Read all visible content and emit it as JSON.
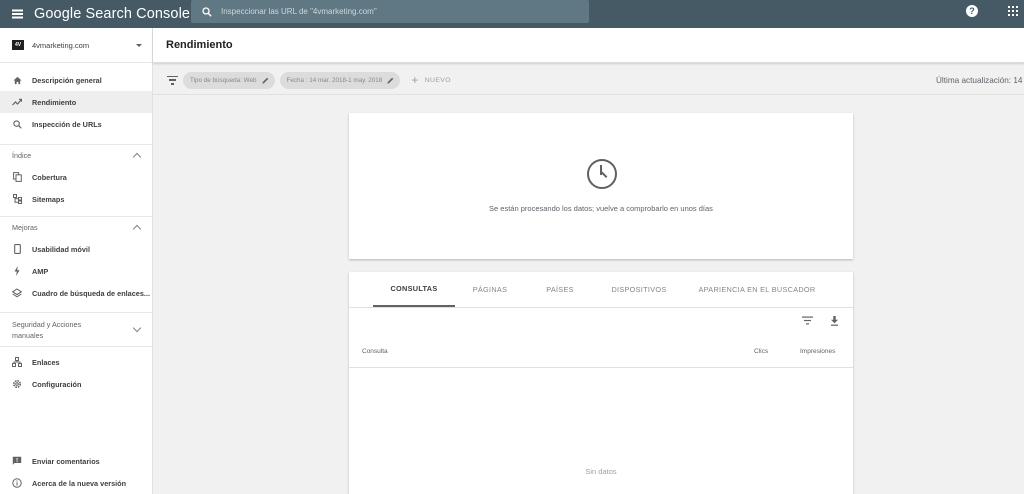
{
  "app": {
    "title": "Google Search Console"
  },
  "search": {
    "placeholder": "Inspeccionar las URL de \"4vmarketing.com\""
  },
  "property": {
    "logo_text": "4V",
    "name": "4vmarketing.com"
  },
  "sidebar": {
    "top_items": [
      {
        "label": "Descripción general",
        "icon": "home-icon"
      },
      {
        "label": "Rendimiento",
        "icon": "trending-up-icon",
        "active": true
      },
      {
        "label": "Inspección de URLs",
        "icon": "search-icon"
      }
    ],
    "sections": [
      {
        "title": "Índice",
        "items": [
          {
            "label": "Cobertura",
            "icon": "file-copy-icon"
          },
          {
            "label": "Sitemaps",
            "icon": "sitemap-icon"
          }
        ]
      },
      {
        "title": "Mejoras",
        "items": [
          {
            "label": "Usabilidad móvil",
            "icon": "phone-icon"
          },
          {
            "label": "AMP",
            "icon": "bolt-icon"
          },
          {
            "label": "Cuadro de búsqueda de enlaces...",
            "icon": "layers-icon"
          }
        ]
      },
      {
        "title": "Seguridad y Acciones manuales"
      }
    ],
    "other_items": [
      {
        "label": "Enlaces",
        "icon": "links-icon"
      },
      {
        "label": "Configuración",
        "icon": "gear-icon"
      }
    ],
    "bottom_items": [
      {
        "label": "Enviar comentarios",
        "icon": "feedback-icon"
      },
      {
        "label": "Acerca de la nueva versión",
        "icon": "info-icon"
      }
    ]
  },
  "header": {
    "title": "Rendimiento"
  },
  "filters": {
    "chips": [
      {
        "label": "Tipo de búsqueda: Web"
      },
      {
        "label": "Fecha : 14 mar. 2018-1 may. 2018"
      }
    ],
    "new_label": "NUEVO",
    "last_update": "Última actualización: 14"
  },
  "status_card": {
    "message": "Se están procesando los datos; vuelve a comprobarlo en unos días"
  },
  "table_card": {
    "tabs": [
      "CONSULTAS",
      "PÁGINAS",
      "PAÍSES",
      "DISPOSITIVOS",
      "APARIENCIA EN EL BUSCADOR"
    ],
    "active_tab": "CONSULTAS",
    "columns": {
      "query": "Consulta",
      "clicks": "Clics",
      "impressions": "Impresiones"
    },
    "empty_message": "Sin datos"
  },
  "colors": {
    "topbar": "#455a64",
    "search_bg": "#5f7884",
    "active_nav": "#eeeeee"
  }
}
